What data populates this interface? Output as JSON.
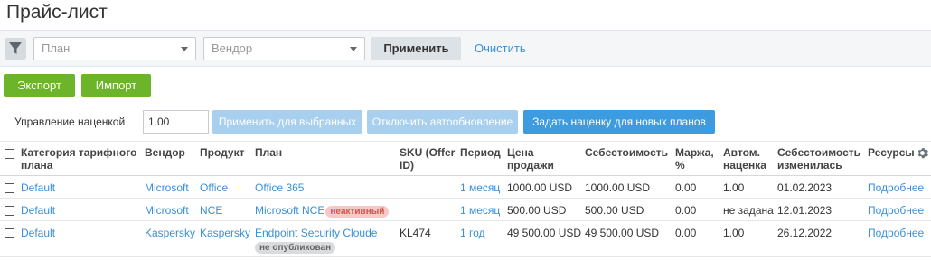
{
  "page": {
    "title": "Прайс-лист"
  },
  "filters": {
    "plan_placeholder": "План",
    "vendor_placeholder": "Вендор",
    "apply_label": "Применить",
    "clear_label": "Очистить"
  },
  "actions": {
    "export_label": "Экспорт",
    "import_label": "Импорт"
  },
  "markup": {
    "label": "Управление наценкой",
    "value": "1.00",
    "apply_selected_label": "Применить для выбранных",
    "disable_autoupdate_label": "Отключить автообновление",
    "set_markup_new_label": "Задать наценку для новых планов"
  },
  "table": {
    "headers": {
      "category": "Категория тарифного плана",
      "vendor": "Вендор",
      "product": "Продукт",
      "plan": "План",
      "sku": "SKU (Offer ID)",
      "period": "Период",
      "price": "Цена продажи",
      "cost": "Себестоимость",
      "margin": "Маржа, %",
      "auto_markup": "Автом. наценка",
      "cost_changed": "Себестоимость изменилась",
      "resources": "Ресурсы"
    },
    "rows": [
      {
        "category": "Default",
        "vendor": "Microsoft",
        "product": "Office",
        "plan": "Office 365",
        "badge": "",
        "sku": "",
        "period": "1 месяц",
        "price": "1000.00 USD",
        "cost": "1000.00 USD",
        "margin": "0.00",
        "auto_markup": "1.00",
        "cost_changed": "01.02.2023",
        "resources": "Подробнее"
      },
      {
        "category": "Default",
        "vendor": "Microsoft",
        "product": "NCE",
        "plan": "Microsoft NCE",
        "badge": "неактивный",
        "sku": "",
        "period": "1 месяц",
        "price": "500.00 USD",
        "cost": "500.00 USD",
        "margin": "0.00",
        "auto_markup": "не задана",
        "cost_changed": "12.01.2023",
        "resources": "Подробнее"
      },
      {
        "category": "Default",
        "vendor": "Kaspersky",
        "product": "Kaspersky",
        "plan": "Endpoint Security Cloude",
        "badge": "не опубликован",
        "sku": "KL474",
        "period": "1 год",
        "price": "49 500.00 USD",
        "cost": "49 500.00 USD",
        "margin": "0.00",
        "auto_markup": "1.00",
        "cost_changed": "26.12.2022",
        "resources": "Подробнее"
      }
    ]
  },
  "colors": {
    "accent_link": "#3a8fd8",
    "green": "#6cb52b",
    "blue": "#3d9be0",
    "blue_disabled": "#a8cfee"
  },
  "icons": {
    "filter": "filter-icon",
    "settings": "gear-icon",
    "dropdown": "chevron-down-icon"
  }
}
